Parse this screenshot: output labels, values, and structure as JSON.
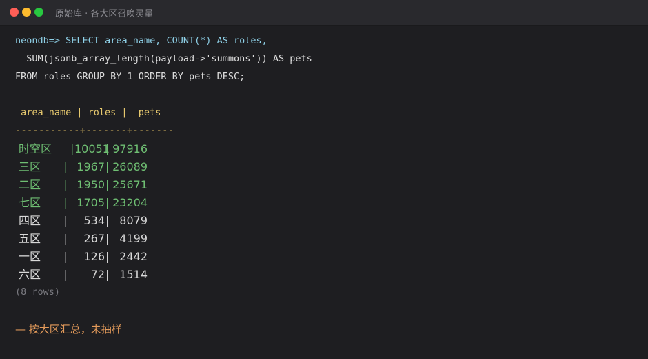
{
  "window": {
    "title": "原始库 · 各大区召唤灵量"
  },
  "query": {
    "prompt": "neondb=>",
    "line1": "SELECT area_name, COUNT(*) AS roles,",
    "line2": "  SUM(jsonb_array_length(payload->'summons')) AS pets",
    "line3": "FROM roles GROUP BY 1 ORDER BY pets DESC;"
  },
  "table": {
    "header": " area_name | roles |  pets",
    "separator": "-----------+-------+-------",
    "rows": [
      {
        "area": "时空区",
        "roles": "10051",
        "pets": "97916",
        "highlight": true
      },
      {
        "area": "三区",
        "roles": "1967",
        "pets": "26089",
        "highlight": true
      },
      {
        "area": "二区",
        "roles": "1950",
        "pets": "25671",
        "highlight": true
      },
      {
        "area": "七区",
        "roles": "1705",
        "pets": "23204",
        "highlight": true
      },
      {
        "area": "四区",
        "roles": "534",
        "pets": "8079",
        "highlight": false
      },
      {
        "area": "五区",
        "roles": "267",
        "pets": "4199",
        "highlight": false
      },
      {
        "area": "一区",
        "roles": "126",
        "pets": "2442",
        "highlight": false
      },
      {
        "area": "六区",
        "roles": "72",
        "pets": "1514",
        "highlight": false
      }
    ],
    "footer": "(8 rows)"
  },
  "comment": "— 按大区汇总，未抽样",
  "colors": {
    "highlight": "#6fbf73",
    "normal": "#d8d8d8",
    "header": "#e6c86e",
    "comment": "#e39a5a",
    "keyword": "#8fd1e8"
  }
}
